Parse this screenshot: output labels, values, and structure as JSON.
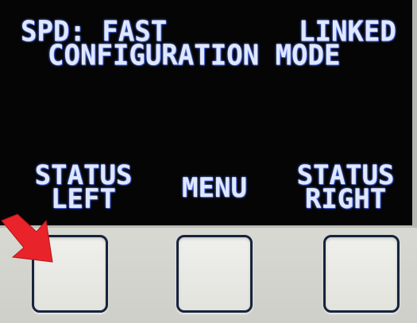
{
  "display": {
    "speed_label": "SPD: FAST",
    "link_status": "LINKED",
    "mode_label": "CONFIGURATION MODE"
  },
  "softkeys": {
    "left": {
      "line1": "STATUS",
      "line2": "LEFT"
    },
    "middle": {
      "label": "MENU"
    },
    "right": {
      "line1": "STATUS",
      "line2": "RIGHT"
    }
  },
  "colors": {
    "screen_bg": "#050505",
    "lcd_text": "#dfe8ff",
    "lcd_glow": "#5a7cff",
    "panel": "#e0e0db",
    "button_border": "#16233c",
    "arrow": "#e8242a"
  },
  "indicator": {
    "icon": "red-arrow-pointer-icon",
    "points_to": "softkey-left-button"
  }
}
